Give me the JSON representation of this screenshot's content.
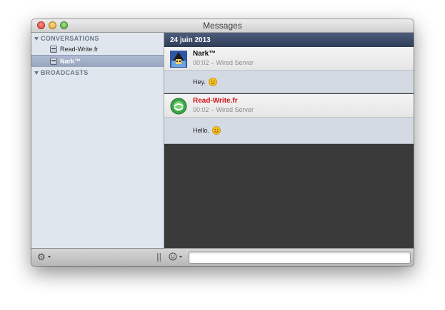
{
  "window": {
    "title": "Messages"
  },
  "sidebar": {
    "conversations_header": "CONVERSATIONS",
    "broadcasts_header": "BROADCASTS",
    "conversations": [
      {
        "label": "Read-Write.fr",
        "selected": false
      },
      {
        "label": "Nark™",
        "selected": true
      }
    ]
  },
  "chat": {
    "date": "24 juin 2013",
    "messages": [
      {
        "nick": "Nark™",
        "meta": "00:02 – Wired Server",
        "text": "Hey.",
        "nick_color": "#111111"
      },
      {
        "nick": "Read-Write.fr",
        "meta": "00:02 – Wired Server",
        "text": "Hello.",
        "nick_color": "#d4151a"
      }
    ]
  },
  "input": {
    "value": "",
    "placeholder": ""
  },
  "icons": {
    "gear": "gear-icon",
    "emoji": "smiley-icon",
    "conversation": "chat-icon"
  }
}
